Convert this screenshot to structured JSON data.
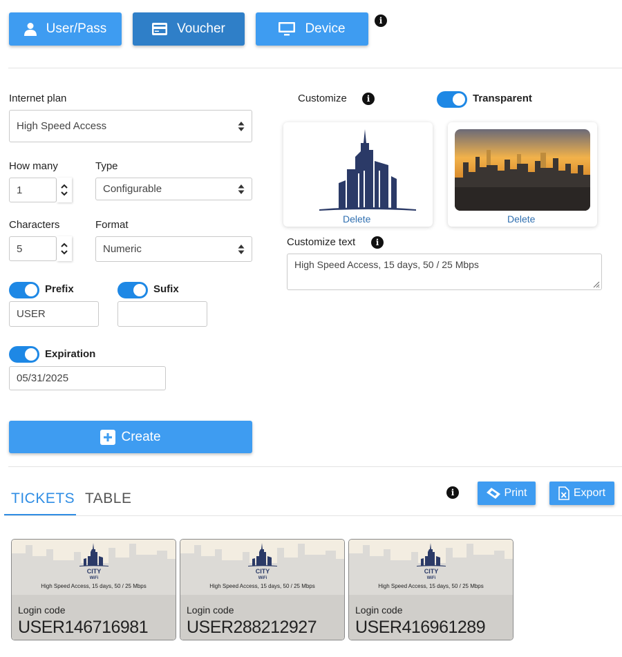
{
  "modes": [
    {
      "label": "User/Pass",
      "icon": "user-icon",
      "active": false
    },
    {
      "label": "Voucher",
      "icon": "credit-card-icon",
      "active": true
    },
    {
      "label": "Device",
      "icon": "monitor-icon",
      "active": false
    }
  ],
  "form": {
    "plan_label": "Internet plan",
    "plan_value": "High Speed Access",
    "how_many_label": "How many",
    "how_many_value": "1",
    "type_label": "Type",
    "type_value": "Configurable",
    "characters_label": "Characters",
    "characters_value": "5",
    "format_label": "Format",
    "format_value": "Numeric",
    "prefix_label": "Prefix",
    "prefix_value": "USER",
    "sufix_label": "Sufix",
    "sufix_value": "",
    "expiration_label": "Expiration",
    "expiration_value": "05/31/2025",
    "create_label": "Create"
  },
  "customize": {
    "label": "Customize",
    "transparent_label": "Transparent",
    "delete_logo": "Delete",
    "delete_background": "Delete",
    "text_label": "Customize text",
    "text_value": "High Speed Access, 15 days, 50 / 25 Mbps"
  },
  "tabs": [
    {
      "label": "TICKETS",
      "active": true
    },
    {
      "label": "TABLE",
      "active": false
    }
  ],
  "actions": {
    "print_label": "Print",
    "export_label": "Export"
  },
  "tickets": [
    {
      "desc": "High Speed Access, 15 days, 50 / 25 Mbps",
      "code_label": "Login code",
      "code": "USER146716981"
    },
    {
      "desc": "High Speed Access, 15 days, 50 / 25 Mbps",
      "code_label": "Login code",
      "code": "USER288212927"
    },
    {
      "desc": "High Speed Access, 15 days, 50 / 25 Mbps",
      "code_label": "Login code",
      "code": "USER416961289"
    }
  ],
  "colors": {
    "primary": "#3e9cf1",
    "primary_active": "#2f7fc8",
    "toggle_on": "#1e88e5",
    "tab_active": "#2f8de4",
    "logo_navy": "#2b3a67"
  }
}
